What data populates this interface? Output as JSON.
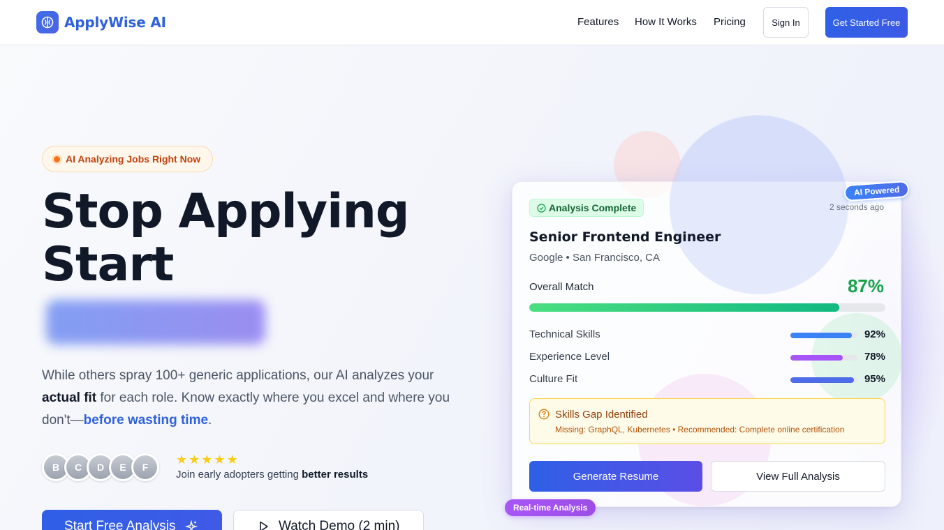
{
  "nav": {
    "brand": "ApplyWise AI",
    "links": [
      "Features",
      "How It Works",
      "Pricing"
    ],
    "sign_in": "Sign In",
    "get_started": "Get Started Free"
  },
  "hero": {
    "badge": "AI Analyzing Jobs Right Now",
    "headline_line1": "Stop Applying",
    "headline_line2": "Start",
    "paragraph": {
      "part1": "While others spray 100+ generic applications, our AI analyzes your ",
      "bold": "actual fit",
      "part2": " for each role. Know exactly where you excel and where you don't—",
      "highlight": "before wasting time",
      "part3": "."
    },
    "avatars": [
      "B",
      "C",
      "D",
      "E",
      "F"
    ],
    "rating_stars": 5,
    "social_prefix": "Join early adopters getting ",
    "social_bold": "better results",
    "start_button": "Start Free Analysis",
    "demo_button": "Watch Demo (2 min)"
  },
  "card": {
    "status": "Analysis Complete",
    "time_ago": "2 seconds ago",
    "ai_badge": "AI Powered",
    "job_title": "Senior Frontend Engineer",
    "job_meta": "Google • San Francisco, CA",
    "overall_label": "Overall Match",
    "overall_value": "87%",
    "overall_fraction": 0.87,
    "skills": [
      {
        "label": "Technical Skills",
        "value": "92%",
        "fraction": 0.92,
        "color": "#3b82f6"
      },
      {
        "label": "Experience Level",
        "value": "78%",
        "fraction": 0.78,
        "color": "#a855f7"
      },
      {
        "label": "Culture Fit",
        "value": "95%",
        "fraction": 0.95,
        "color": "#4f6ce8"
      }
    ],
    "gap_title": "Skills Gap Identified",
    "gap_detail": "Missing: GraphQL, Kubernetes • Recommended: Complete online certification",
    "generate_button": "Generate Resume",
    "view_button": "View Full Analysis",
    "realtime_badge": "Real-time Analysis"
  },
  "colors": {
    "brand": "#2f61db",
    "accent_green": "#16a34a",
    "warning": "#92400e"
  },
  "icons": {
    "logo": "brain-icon",
    "status": "check-circle-icon",
    "gap": "question-circle-icon",
    "start": "sparkles-icon",
    "demo": "play-icon"
  }
}
